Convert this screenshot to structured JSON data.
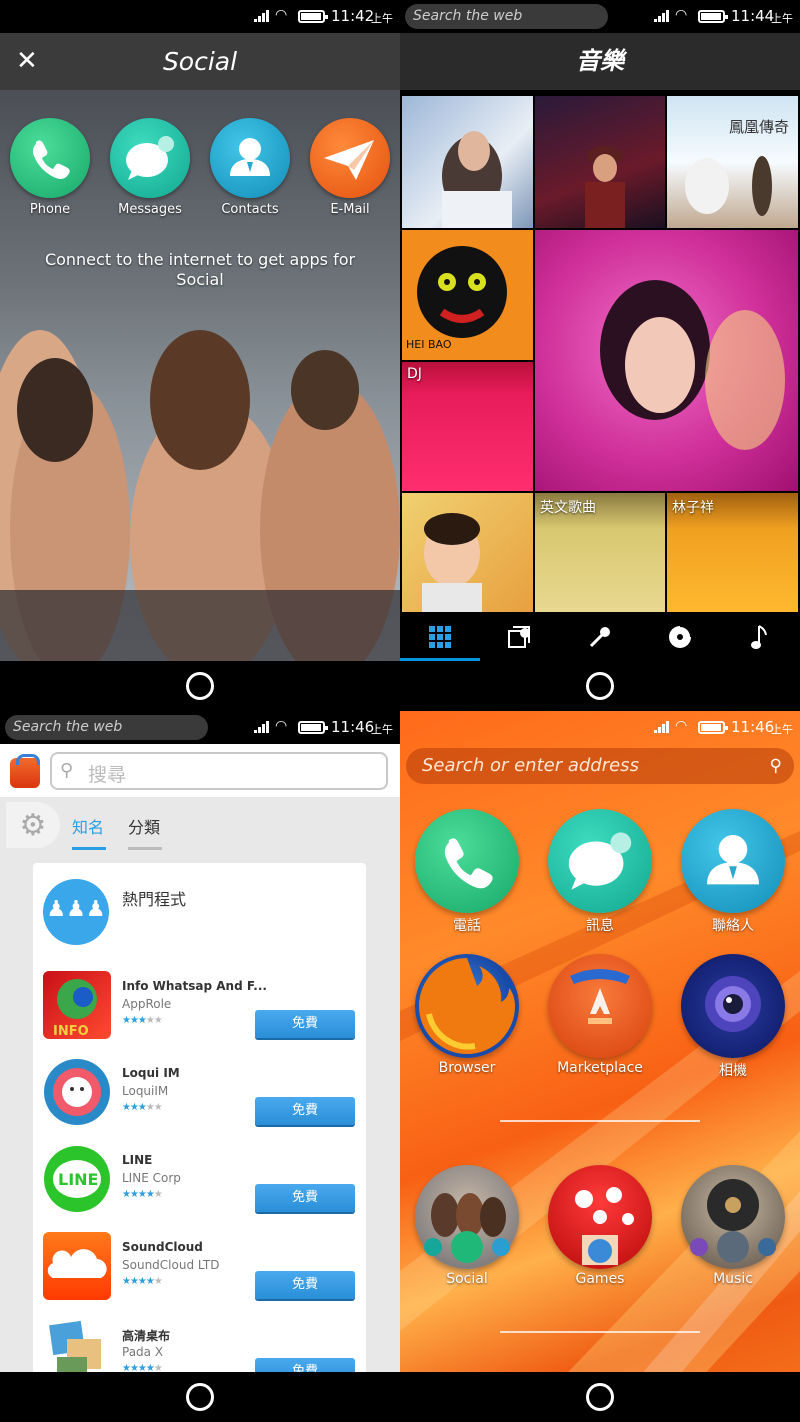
{
  "status_bars": [
    {
      "time": "11:42",
      "ampm": "上午"
    },
    {
      "time": "11:44",
      "ampm": "上午",
      "search_placeholder": "Search the web"
    },
    {
      "time": "11:46",
      "ampm": "上午",
      "search_placeholder": "Search the web"
    },
    {
      "time": "11:46",
      "ampm": "上午"
    }
  ],
  "social": {
    "title": "Social",
    "close_icon": "✕",
    "apps": [
      {
        "label": "Phone",
        "icon": "phone-icon"
      },
      {
        "label": "Messages",
        "icon": "messages-icon"
      },
      {
        "label": "Contacts",
        "icon": "contacts-icon"
      },
      {
        "label": "E-Mail",
        "icon": "email-icon"
      }
    ],
    "message": "Connect to the internet to get apps for Social"
  },
  "music": {
    "title": "音樂",
    "tiles": [
      "DJ",
      "英文歌曲",
      "林子祥"
    ],
    "tabs": [
      "mix-icon",
      "playlists-icon",
      "artists-icon",
      "albums-icon",
      "songs-icon"
    ],
    "active_tab": 0
  },
  "marketplace": {
    "search_placeholder": "搜尋",
    "tabs": [
      "知名",
      "分類"
    ],
    "section_title": "熱門程式",
    "free_label": "免費",
    "apps": [
      {
        "name": "Info Whatsap And F...",
        "developer": "AppRole",
        "stars": 3
      },
      {
        "name": "Loqui IM",
        "developer": "LoquiIM",
        "stars": 3
      },
      {
        "name": "LINE",
        "developer": "LINE Corp",
        "stars": 4
      },
      {
        "name": "SoundCloud",
        "developer": "SoundCloud LTD",
        "stars": 4
      },
      {
        "name": "高清桌布",
        "developer": "Pada X",
        "stars": 4
      }
    ]
  },
  "home": {
    "address_placeholder": "Search or enter address",
    "row1": [
      "電話",
      "訊息",
      "聯絡人"
    ],
    "row2": [
      "Browser",
      "Marketplace",
      "相機"
    ],
    "row3": [
      "Social",
      "Games",
      "Music"
    ]
  },
  "colors": {
    "accent": "#0095dd",
    "market_blue": "#2b9fe4",
    "home_orange": "#ff6a1a"
  }
}
